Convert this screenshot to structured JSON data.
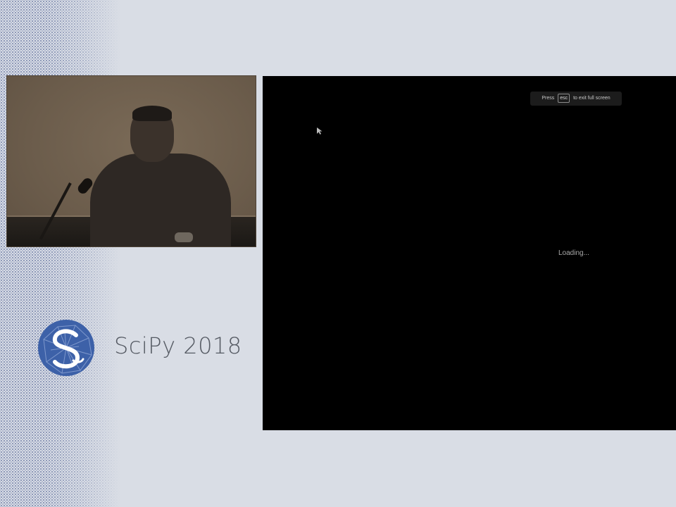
{
  "conference": {
    "name": "SciPy 2018",
    "logo_icon": "scipy-logo-icon"
  },
  "video": {
    "scene": "presenter-camera"
  },
  "screen_share": {
    "fullscreen_notice": {
      "prefix": "Press",
      "key": "esc",
      "suffix": "to exit full screen"
    },
    "status_text": "Loading..."
  },
  "colors": {
    "page_background": "#d9dde5",
    "logo_blue": "#3d61a8",
    "brand_text": "#555a63",
    "screen_background": "#000000"
  }
}
